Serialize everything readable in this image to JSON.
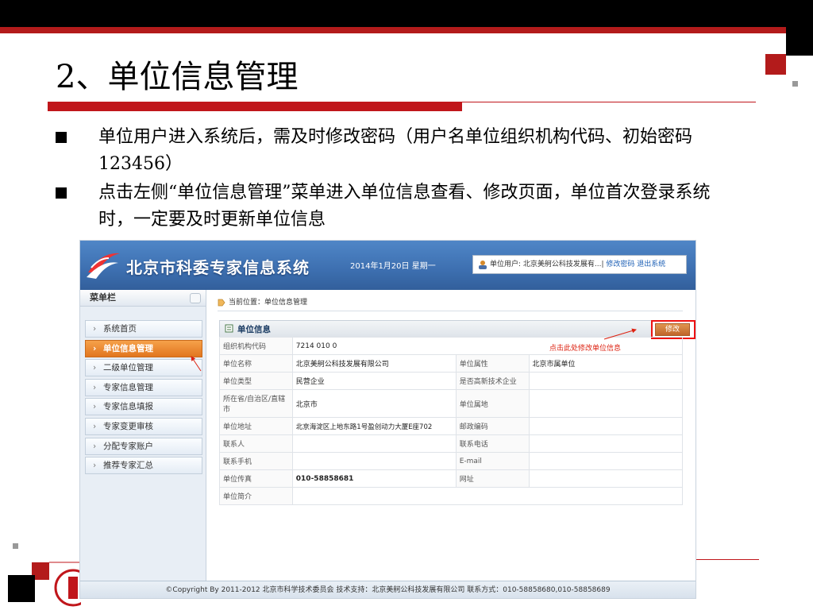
{
  "slide": {
    "title": "2、单位信息管理",
    "bullets": [
      "单位用户进入系统后，需及时修改密码（用户名单位组织机构代码、初始密码123456）",
      "点击左侧“单位信息管理”菜单进入单位信息查看、修改页面，单位首次登录系统时，一定要及时更新单位信息"
    ],
    "accent_color": "#c0161b"
  },
  "app": {
    "system_title": "北京市科委专家信息系统",
    "date": "2014年1月20日 星期一",
    "user_label": "单位用户: 北京美舸公科技发展有...|",
    "change_password": "修改密码",
    "logout": "退出系统",
    "menu_title": "菜单栏",
    "menu_items": [
      "系统首页",
      "单位信息管理",
      "二级单位管理",
      "专家信息管理",
      "专家信息填报",
      "专家变更审核",
      "分配专家账户",
      "推荐专家汇总"
    ],
    "breadcrumb": "当前位置：单位信息管理",
    "panel_title": "单位信息",
    "edit_button": "修改",
    "edit_note": "点击此处修改单位信息",
    "fields": {
      "org_code_label": "组织机构代码",
      "org_code_value": "7214 010 0",
      "name_label": "单位名称",
      "name_value": "北京美舸公科技发展有限公司",
      "attr_label": "单位属性",
      "attr_value": "北京市属单位",
      "type_label": "单位类型",
      "type_value": "民营企业",
      "hightech_label": "是否高新技术企业",
      "hightech_value": "",
      "province_label": "所在省/自治区/直辖市",
      "province_value": "北京市",
      "location_label": "单位属地",
      "location_value": "",
      "address_label": "单位地址",
      "address_value": "北京海淀区上地东路1号盈创动力大厦E座702",
      "postcode_label": "邮政编码",
      "postcode_value": "",
      "contact_label": "联系人",
      "contact_value": "",
      "phone_label": "联系电话",
      "phone_value": "",
      "mobile_label": "联系手机",
      "mobile_value": "",
      "email_label": "E-mail",
      "email_value": "",
      "fax_label": "单位传真",
      "fax_value": "010-58858681",
      "website_label": "网址",
      "website_value": "",
      "intro_label": "单位简介",
      "intro_value": ""
    },
    "footer": "©Copyright By 2011-2012 北京市科学技术委员会    技术支持：北京美舸公科技发展有限公司    联系方式：010-58858680,010-58858689"
  }
}
